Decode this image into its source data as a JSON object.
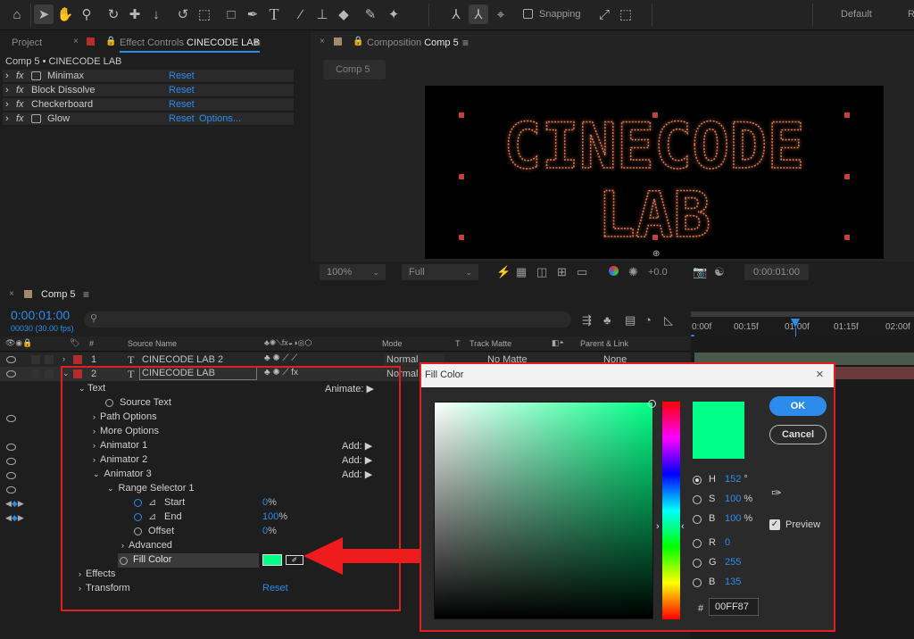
{
  "toolbar": {
    "snapping_label": "Snapping",
    "workspace_default": "Default",
    "workspace_review_partial": "R"
  },
  "project_panel": {
    "tab_project": "Project",
    "tab_effect_controls": "Effect Controls",
    "effect_controls_layer": "CINECODE LAB",
    "comp_layer_path": "Comp 5 • CINECODE LAB",
    "effects": [
      {
        "name": "Minimax",
        "reset": "Reset",
        "options": ""
      },
      {
        "name": "Block Dissolve",
        "reset": "Reset",
        "options": ""
      },
      {
        "name": "Checkerboard",
        "reset": "Reset",
        "options": ""
      },
      {
        "name": "Glow",
        "reset": "Reset",
        "options": "Options..."
      }
    ]
  },
  "composition_panel": {
    "tab_label": "Composition",
    "comp_name": "Comp 5",
    "comp_chip": "Comp 5",
    "canvas_line1": "CINECODE",
    "canvas_line2": "LAB",
    "zoom": "100%",
    "resolution": "Full",
    "exposure": "+0.0",
    "timecode": "0:00:01:00"
  },
  "timeline": {
    "tab_label": "Comp 5",
    "current_time": "0:00:01:00",
    "frame_info": "00030 (30.00 fps)",
    "search_placeholder": "",
    "col_hash": "#",
    "col_source_name": "Source Name",
    "col_mode": "Mode",
    "col_t": "T",
    "col_track_matte": "Track Matte",
    "col_parent": "Parent & Link",
    "ruler": [
      "0:00f",
      "00:15f",
      "01:00f",
      "01:15f",
      "02:00f"
    ],
    "layers": [
      {
        "num": "1",
        "type_icon": "T",
        "name": "CINECODE LAB 2",
        "mode": "Normal",
        "matte": "No Matte",
        "parent": "None"
      },
      {
        "num": "2",
        "type_icon": "T",
        "name": "CINECODE LAB",
        "mode": "Normal",
        "matte": "",
        "parent": ""
      }
    ],
    "props": {
      "text": "Text",
      "animate": "Animate:",
      "source_text": "Source Text",
      "path_options": "Path Options",
      "more_options": "More Options",
      "animator1": "Animator 1",
      "animator2": "Animator 2",
      "animator3": "Animator 3",
      "add": "Add:",
      "range_selector": "Range Selector 1",
      "start": "Start",
      "start_val": "0",
      "end": "End",
      "end_val": "100",
      "offset": "Offset",
      "offset_val": "0",
      "percent": "%",
      "advanced": "Advanced",
      "fill_color": "Fill Color",
      "fill_hex": "#00ff87",
      "effects": "Effects",
      "transform": "Transform",
      "transform_reset": "Reset"
    }
  },
  "fill_dialog": {
    "title": "Fill Color",
    "ok": "OK",
    "cancel": "Cancel",
    "preview": "Preview",
    "h_label": "H",
    "h_val": "152",
    "h_unit": "°",
    "s_label": "S",
    "s_val": "100",
    "s_unit": "%",
    "b_label": "B",
    "b_val": "100",
    "b_unit": "%",
    "r_label": "R",
    "r_val": "0",
    "g_label": "G",
    "g_val": "255",
    "b2_label": "B",
    "b2_val": "135",
    "hash": "#",
    "hex": "00FF87",
    "swatch_color": "#00ff87"
  },
  "colors": {
    "accent_blue": "#2d8ceb",
    "highlight_red": "#e02020",
    "fill_green": "#00ff87"
  }
}
